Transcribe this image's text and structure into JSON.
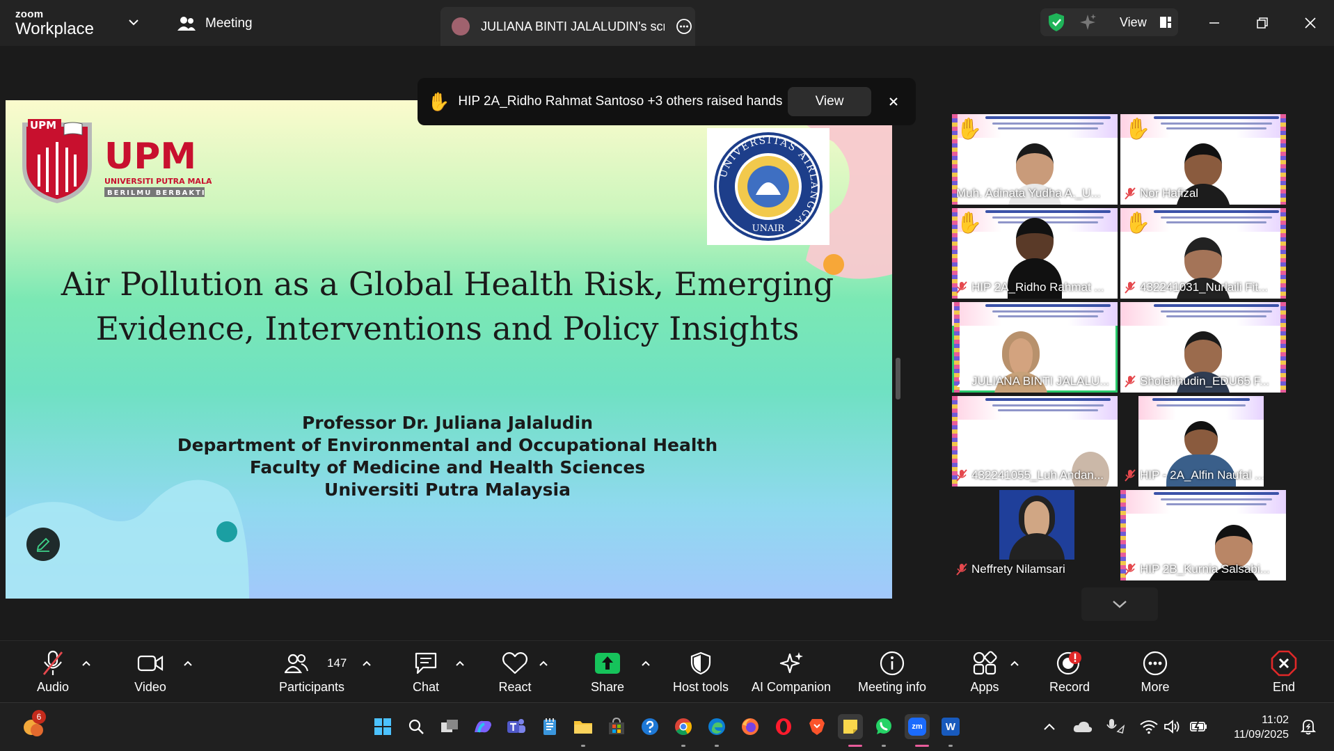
{
  "titlebar": {
    "logo_small": "zoom",
    "logo_large": "Workplace",
    "meeting_tab": "Meeting",
    "screen_tab": "JULIANA BINTI JALALUDIN's scree",
    "view_label": "View"
  },
  "toast": {
    "text": "HIP 2A_Ridho Rahmat Santoso +3 others raised hands",
    "view_label": "View"
  },
  "slide": {
    "title_line1": "Air Pollution as a Global Health Risk, Emerging",
    "title_line2": "Evidence, Interventions and Policy Insights",
    "author_lines": [
      "Professor Dr. Juliana Jalaludin",
      "Department of Environmental and Occupational Health",
      "Faculty of Medicine and Health Sciences",
      "Universiti Putra Malaysia"
    ],
    "upm_badge": "UPM",
    "upm_word": "UPM",
    "upm_sub1": "UNIVERSITI PUTRA MALAYSIA",
    "upm_sub2": "BERILMU BERBAKTI",
    "unair_ring": "UNIVERSITAS AIRLANGGA",
    "unair_bottom": "UNAIR"
  },
  "gallery": {
    "tiles": [
      {
        "name": "Muh. Adinata Yudha A._U...",
        "hand": true,
        "muted": false
      },
      {
        "name": "Nor Hafizal",
        "hand": true,
        "muted": true
      },
      {
        "name": "HIP 2A_Ridho Rahmat ...",
        "hand": true,
        "muted": true
      },
      {
        "name": "432241031_Nurlaili Fit...",
        "hand": true,
        "muted": true
      },
      {
        "name": "JULIANA BINTI JALALU...",
        "hand": false,
        "muted": false,
        "active": true
      },
      {
        "name": "Sholehhudin_EDU65 F...",
        "hand": false,
        "muted": true
      },
      {
        "name": "432241055_Luh Andan...",
        "hand": false,
        "muted": true
      },
      {
        "name": "HIP - 2A_Alfin Naufal ...",
        "hand": false,
        "muted": true
      },
      {
        "name": "Neffrety Nilamsari",
        "hand": false,
        "muted": true
      },
      {
        "name": "HIP 2B_Kurnia Salsabi...",
        "hand": false,
        "muted": true
      }
    ]
  },
  "toolbar": {
    "audio": "Audio",
    "video": "Video",
    "participants": "Participants",
    "participants_count": "147",
    "chat": "Chat",
    "react": "React",
    "share": "Share",
    "host_tools": "Host tools",
    "ai_companion": "AI Companion",
    "meeting_info": "Meeting info",
    "apps": "Apps",
    "record": "Record",
    "more": "More",
    "end": "End"
  },
  "taskbar": {
    "weather_count": "6",
    "time": "11:02",
    "date": "11/09/2025",
    "word_icon": "W",
    "zoom_icon": "zm"
  },
  "colors": {
    "share_green": "#16c35b",
    "end_red": "#e02828",
    "active_speaker": "#29c96b",
    "shield_green": "#1fb459"
  }
}
